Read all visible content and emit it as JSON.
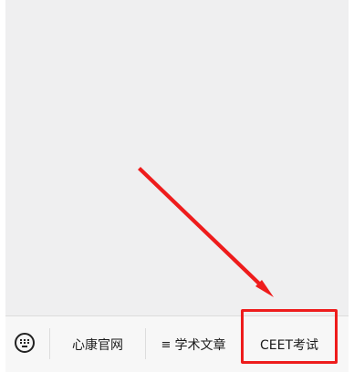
{
  "menu": {
    "keyboard_icon": "keyboard-icon",
    "items": [
      {
        "label": "心康官网",
        "glyph": ""
      },
      {
        "label": "学术文章",
        "glyph": "≡"
      },
      {
        "label": "CEET考试",
        "glyph": ""
      }
    ]
  },
  "annotation": {
    "color": "#ee1c1c"
  }
}
